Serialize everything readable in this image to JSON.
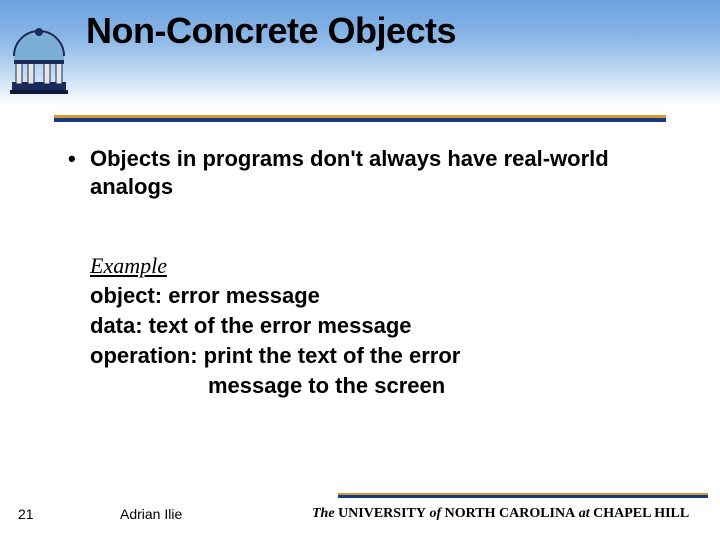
{
  "title": "Non-Concrete Objects",
  "bullets": [
    "Objects in programs don't always have real-world analogs"
  ],
  "example": {
    "label": "Example",
    "lines": [
      "object: error message",
      "data: text of the error message",
      "operation: print the text of the error",
      "message to the screen"
    ]
  },
  "footer": {
    "slide_number": "21",
    "author": "Adrian Ilie",
    "university": {
      "the": "The",
      "university": "UNIVERSITY",
      "of": "of",
      "north_carolina": "NORTH  CAROLINA",
      "at": "at",
      "chapel_hill": "CHAPEL HILL"
    }
  }
}
